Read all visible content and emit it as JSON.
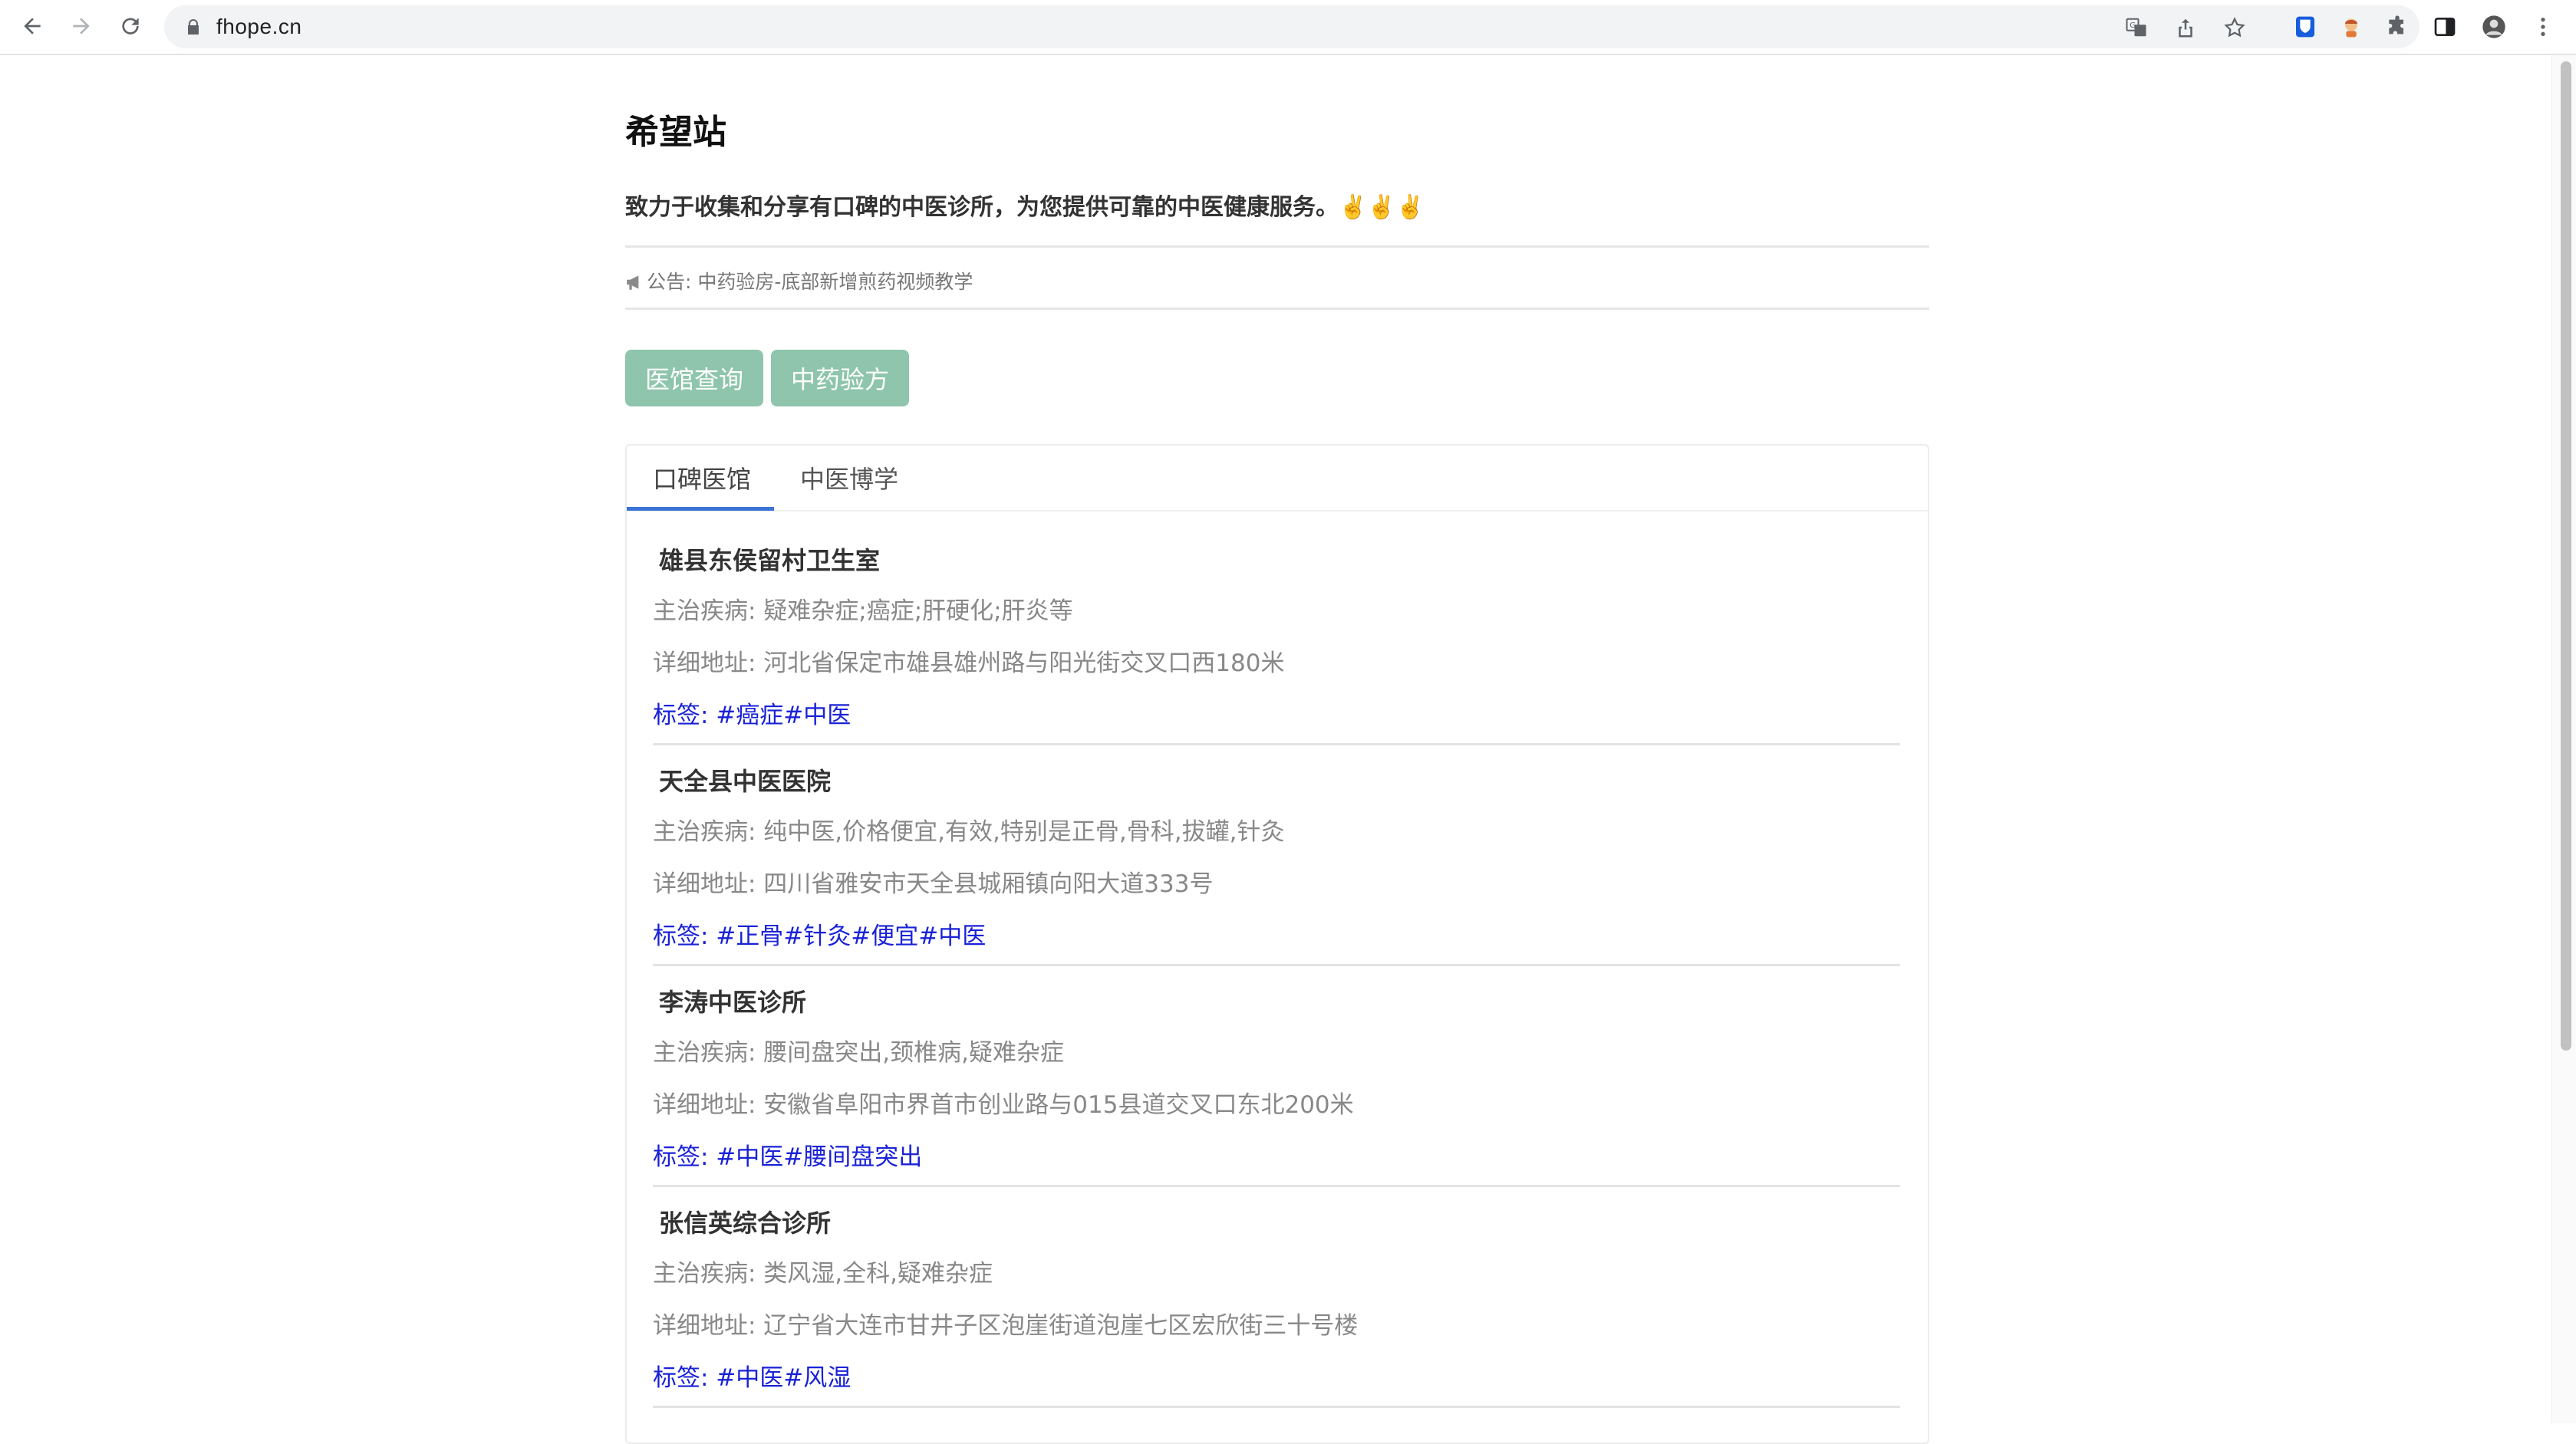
{
  "browser": {
    "url": "fhope.cn",
    "back_icon": "arrow-left-icon",
    "forward_icon": "arrow-right-icon",
    "reload_icon": "reload-icon",
    "lock_icon": "lock-icon"
  },
  "site": {
    "title": "希望站",
    "tagline": "致力于收集和分享有口碑的中医诊所，为您提供可靠的中医健康服务。✌️✌️✌️",
    "notice": "公告: 中药验房-底部新增煎药视频教学"
  },
  "buttons": {
    "clinic_search": "医馆查询",
    "herbal_recipes": "中药验方"
  },
  "tabs": [
    {
      "label": "口碑医馆",
      "active": true
    },
    {
      "label": "中医博学",
      "active": false
    }
  ],
  "clinics": [
    {
      "name": "雄县东侯留村卫生室",
      "diseases": "主治疾病: 疑难杂症;癌症;肝硬化;肝炎等",
      "address": "详细地址: 河北省保定市雄县雄州路与阳光街交叉口西180米",
      "tags": "标签: #癌症#中医"
    },
    {
      "name": "天全县中医医院",
      "diseases": "主治疾病: 纯中医,价格便宜,有效,特别是正骨,骨科,拔罐,针灸",
      "address": "详细地址: 四川省雅安市天全县城厢镇向阳大道333号",
      "tags": "标签: #正骨#针灸#便宜#中医"
    },
    {
      "name": "李涛中医诊所",
      "diseases": "主治疾病: 腰间盘突出,颈椎病,疑难杂症",
      "address": "详细地址: 安徽省阜阳市界首市创业路与015县道交叉口东北200米",
      "tags": "标签: #中医#腰间盘突出"
    },
    {
      "name": "张信英综合诊所",
      "diseases": "主治疾病: 类风湿,全科,疑难杂症",
      "address": "详细地址: 辽宁省大连市甘井子区泡崖街道泡崖七区宏欣街三十号楼",
      "tags": "标签: #中医#风湿"
    }
  ],
  "colors": {
    "button_bg": "#8ec5ac",
    "tag_text": "#1a22d6",
    "tab_underline": "#3b73d6"
  }
}
